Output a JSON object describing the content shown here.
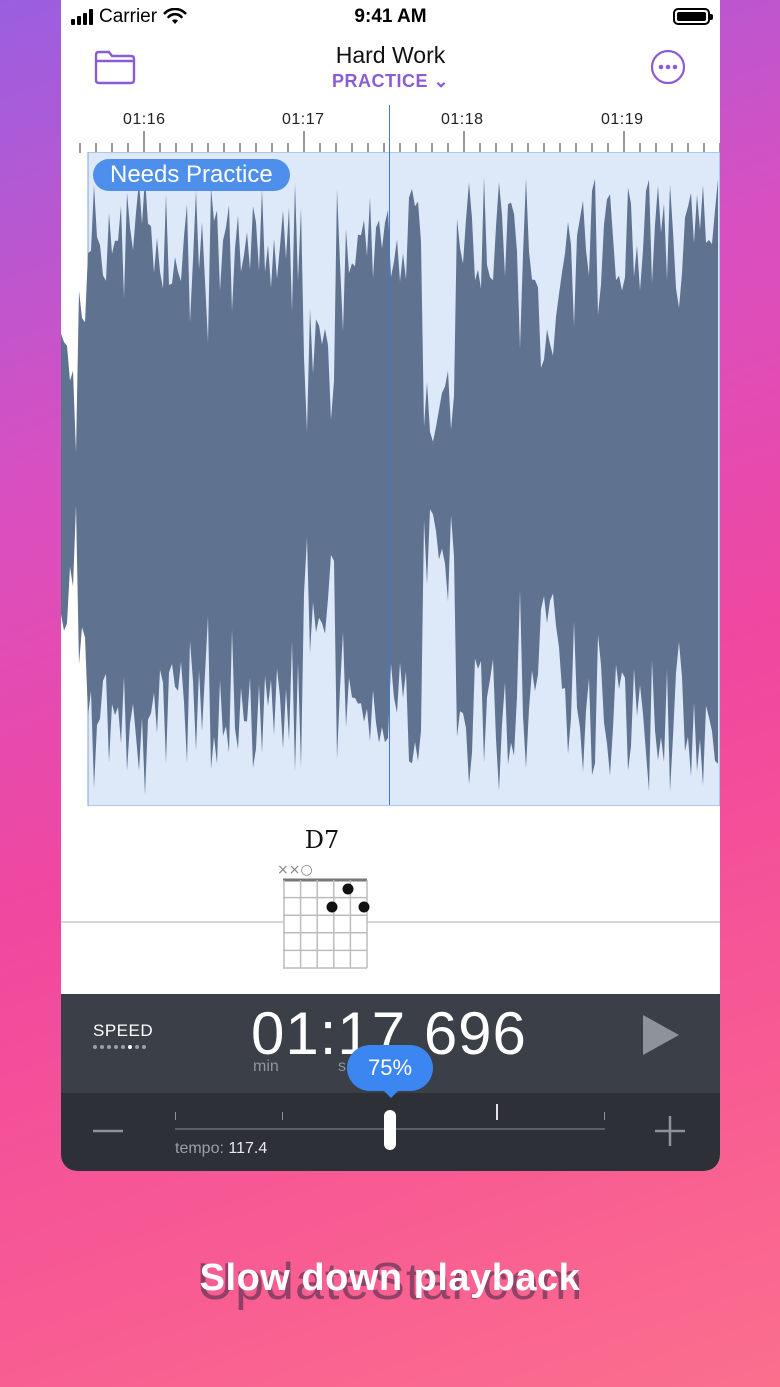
{
  "status_bar": {
    "carrier": "Carrier",
    "time": "9:41 AM"
  },
  "nav": {
    "title": "Hard Work",
    "mode": "PRACTICE ⌄"
  },
  "ruler": {
    "labels": [
      "01:16",
      "01:17",
      "01:18",
      "01:19"
    ]
  },
  "region": {
    "label": "Needs Practice"
  },
  "chord": {
    "name": "D7",
    "open_markers": "××○"
  },
  "transport": {
    "speed_label": "SPEED",
    "time": "01:17.696",
    "min_unit": "min",
    "sec_unit": "s"
  },
  "tempo": {
    "speed_value": "75%",
    "tempo_prefix": "tempo: ",
    "tempo_value": "117.4",
    "speed_fraction": 0.5
  },
  "caption": "Slow down playback",
  "watermark": "UpdateStar.com",
  "colors": {
    "accent_purple": "#8a5cd6",
    "region_fill": "#dde8f8",
    "waveform": "#5f728f",
    "region_label": "#4d8fea",
    "slider_bubble": "#3b86f0"
  },
  "icons": [
    "folder-icon",
    "more-icon",
    "play-icon",
    "minus-icon",
    "plus-icon"
  ]
}
